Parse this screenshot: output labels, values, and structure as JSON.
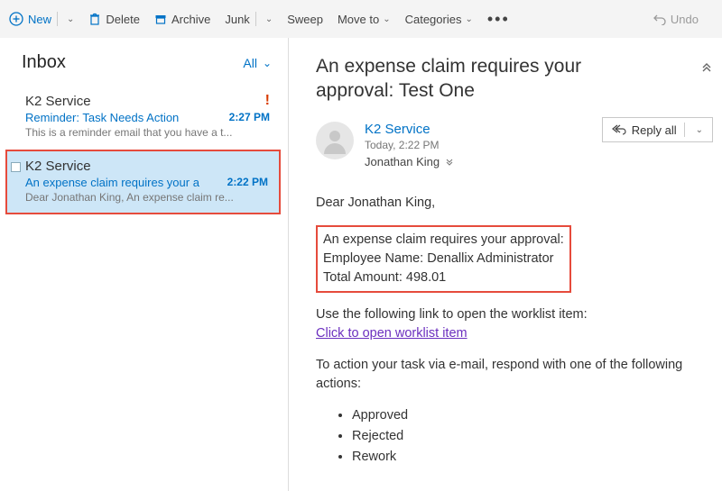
{
  "toolbar": {
    "new_label": "New",
    "delete_label": "Delete",
    "archive_label": "Archive",
    "junk_label": "Junk",
    "sweep_label": "Sweep",
    "moveto_label": "Move to",
    "categories_label": "Categories",
    "undo_label": "Undo"
  },
  "list": {
    "inbox_title": "Inbox",
    "filter_label": "All",
    "items": [
      {
        "sender": "K2 Service",
        "important": true,
        "subject": "Reminder: Task Needs Action",
        "time": "2:27 PM",
        "preview": "This is a reminder email that you have a t..."
      },
      {
        "sender": "K2 Service",
        "important": false,
        "subject": "An expense claim requires your a",
        "time": "2:22 PM",
        "preview": "Dear Jonathan King,  An expense claim re..."
      }
    ]
  },
  "reading": {
    "title": "An expense claim requires your approval: Test One",
    "from": "K2 Service",
    "when": "Today, 2:22 PM",
    "to": "Jonathan King",
    "reply_label": "Reply all",
    "greeting": "Dear Jonathan King,",
    "highlight_line1": "An expense claim requires your approval:",
    "highlight_line2": "Employee Name: Denallix Administrator",
    "highlight_line3": "Total Amount: 498.01",
    "link_intro": "Use the following link to open the worklist item:",
    "link_text": "Click to open worklist item",
    "action_intro": "To action your task via e-mail, respond with one of the following actions:",
    "actions": [
      "Approved",
      "Rejected",
      "Rework"
    ]
  }
}
